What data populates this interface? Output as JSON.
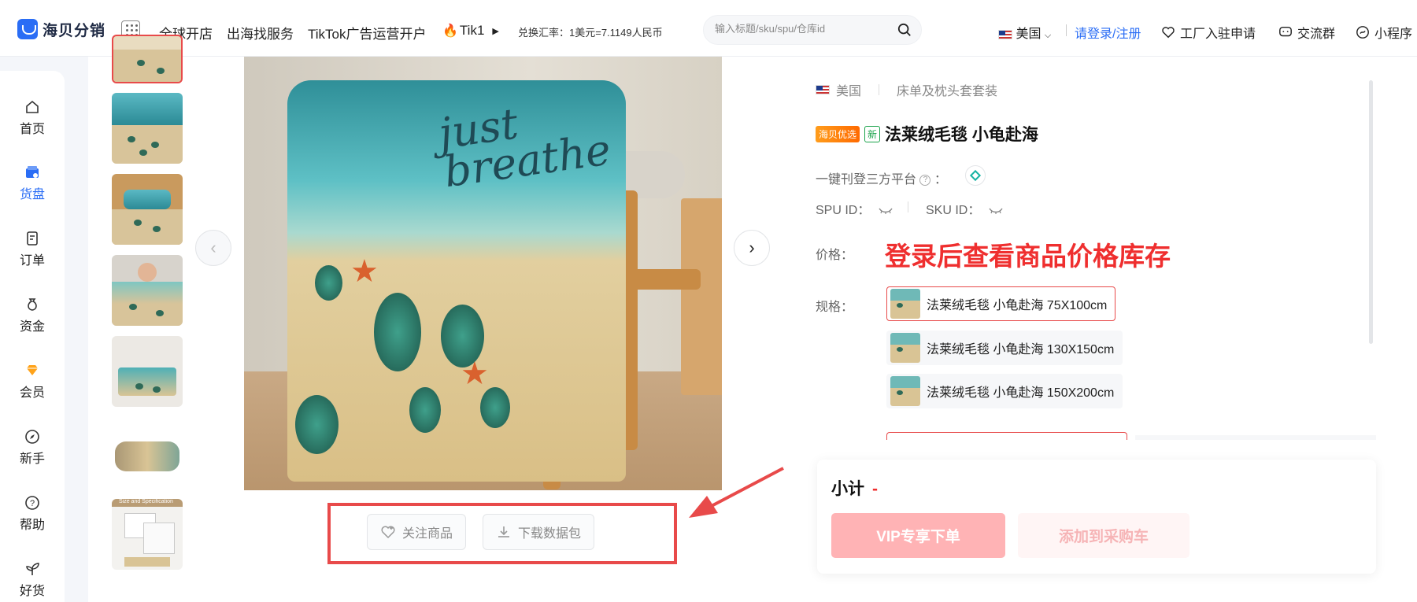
{
  "header": {
    "logo_text": "海贝分销",
    "nav": [
      "全球开店",
      "出海找服务",
      "TikTok广告运营开户",
      "Tik1"
    ],
    "exchange_rate": "兑换汇率：1美元=7.1149人民币",
    "search_placeholder": "输入标题/sku/spu/仓库id",
    "country": "美国",
    "login": "请登录/注册",
    "factory": "工厂入驻申请",
    "group": "交流群",
    "miniprogram": "小程序"
  },
  "sidebar": {
    "items": [
      {
        "label": "首页",
        "icon": "home-icon"
      },
      {
        "label": "货盘",
        "icon": "shop-icon",
        "active": true
      },
      {
        "label": "订单",
        "icon": "order-icon"
      },
      {
        "label": "资金",
        "icon": "money-bag-icon"
      },
      {
        "label": "会员",
        "icon": "diamond-icon"
      },
      {
        "label": "新手",
        "icon": "compass-icon"
      },
      {
        "label": "帮助",
        "icon": "help-icon"
      },
      {
        "label": "好货",
        "icon": "sprout-icon"
      }
    ]
  },
  "gallery": {
    "thumb_labels": [
      "Size and Specification"
    ],
    "actions": {
      "follow": "关注商品",
      "download": "下载数据包"
    }
  },
  "product": {
    "country": "美国",
    "category": "床单及枕头套套装",
    "badge_preferred": "海贝优选",
    "badge_new": "新",
    "title": "法莱绒毛毯 小龟赴海",
    "listing_label": "一键刊登三方平台",
    "listing_colon": "：",
    "spu_label": "SPU ID：",
    "sku_label": "SKU ID：",
    "price_label": "价格：",
    "price_login_text": "登录后查看商品价格库存",
    "spec_label": "规格：",
    "specs": [
      "法莱绒毛毯 小龟赴海 75X100cm",
      "法莱绒毛毯 小龟赴海 130X150cm",
      "法莱绒毛毯 小龟赴海 150X200cm"
    ]
  },
  "cart": {
    "subtotal_label": "小计",
    "subtotal_value": "-",
    "vip_order": "VIP专享下单",
    "add_to_cart": "添加到采购车"
  },
  "colors": {
    "accent": "#2a6df5",
    "highlight": "#e84a4a",
    "price_red": "#ef2f2f"
  }
}
